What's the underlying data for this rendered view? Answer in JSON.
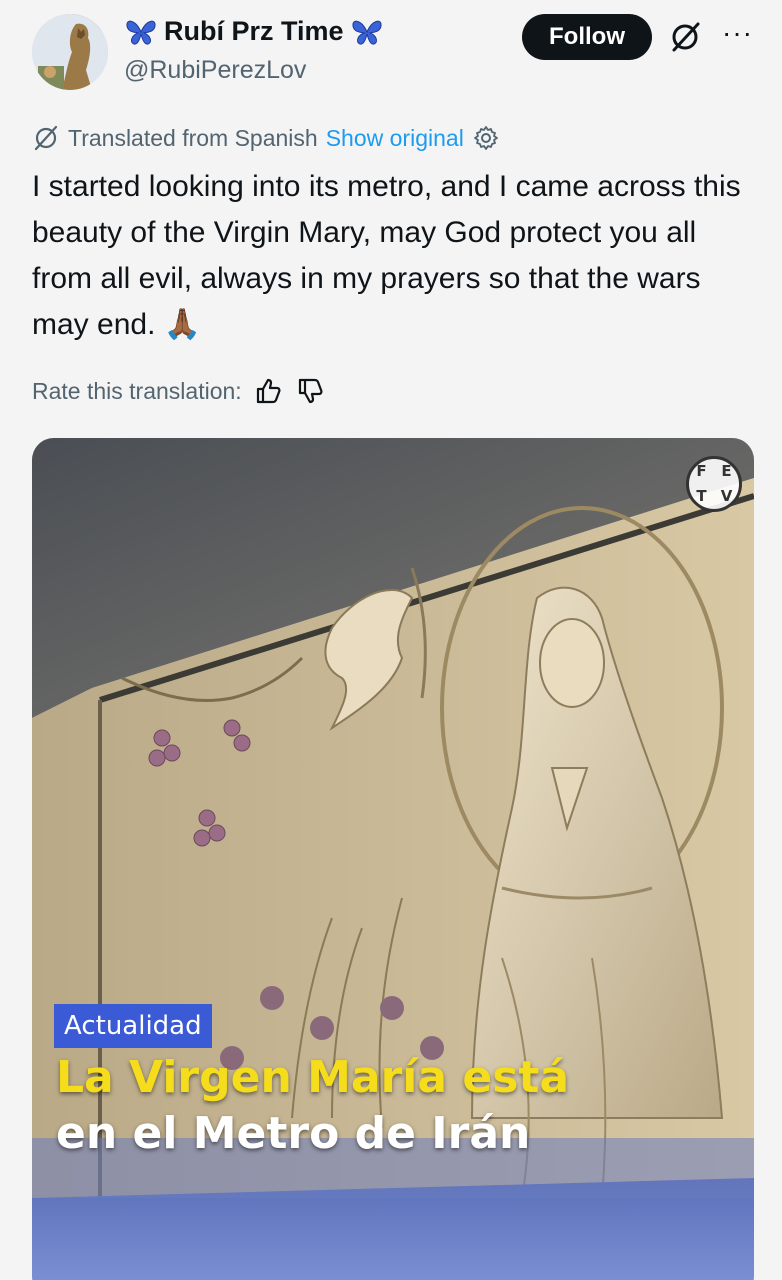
{
  "header": {
    "display_name": "Rubí Prz Time",
    "handle": "@RubiPerezLov",
    "follow_label": "Follow",
    "more_label": "···"
  },
  "translation": {
    "translated_from": "Translated from Spanish",
    "show_original": "Show original"
  },
  "tweet": {
    "text": "I started looking into its metro, and I came across this beauty of the Virgin Mary, may God protect you all from all evil, always in my prayers so that the wars may end. 🙏🏾"
  },
  "rate": {
    "label": "Rate this translation:"
  },
  "media": {
    "logo": [
      "F",
      "E",
      "T",
      "V"
    ],
    "category": "Actualidad",
    "headline_line1": "La Virgen María está",
    "headline_line2": "en el Metro de Irán"
  },
  "colors": {
    "follow_bg": "#0f1419",
    "link": "#1d9bf0",
    "muted": "#536471",
    "butterfly": "#3a63d8",
    "headline_yellow": "#f5dd1c",
    "tag_bg": "#3b5bd6"
  },
  "icons": {
    "butterfly": "butterfly-icon",
    "grok": "grok-icon",
    "translate": "translate-icon",
    "settings": "gear-icon",
    "thumbs_up": "thumbs-up-icon",
    "thumbs_down": "thumbs-down-icon"
  }
}
